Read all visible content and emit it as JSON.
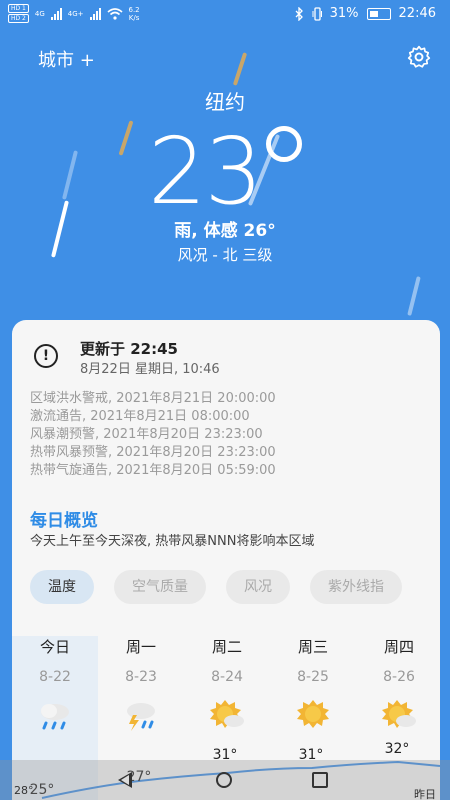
{
  "status_bar": {
    "sim1": "HD 1",
    "sim2": "HD 2",
    "net1": "4G",
    "net2": "4G+",
    "speed_value": "6.2",
    "speed_unit": "K/s",
    "battery": "31%",
    "time": "22:46"
  },
  "header": {
    "city_label": "城市 +",
    "settings_icon": "gear-icon"
  },
  "current": {
    "city": "纽约",
    "temperature": "23",
    "condition": "雨, 体感 26°",
    "wind": "风况 - 北 三级"
  },
  "card": {
    "updated_title": "更新于 22:45",
    "updated_date": "8月22日  星期日, 10:46",
    "warnings": [
      "区域洪水警戒, 2021年8月21日 20:00:00",
      "激流通告, 2021年8月21日 08:00:00",
      "风暴潮预警, 2021年8月20日 23:23:00",
      "热带风暴预警, 2021年8月20日 23:23:00",
      "热带气旋通告, 2021年8月20日 05:59:00"
    ],
    "daily_title": "每日概览",
    "daily_desc": "今天上午至今天深夜, 热带风暴NNN将影响本区域"
  },
  "tabs": [
    "温度",
    "空气质量",
    "风况",
    "紫外线指"
  ],
  "forecast": [
    {
      "day": "今日",
      "date": "8-22",
      "icon": "rain-cloud-icon",
      "high": "",
      "low": "25°"
    },
    {
      "day": "周一",
      "date": "8-23",
      "icon": "thunderstorm-icon",
      "high": "",
      "low": "27°"
    },
    {
      "day": "周二",
      "date": "8-24",
      "icon": "sun-cloud-icon",
      "high": "31°",
      "low": ""
    },
    {
      "day": "周三",
      "date": "8-25",
      "icon": "sun-icon",
      "high": "31°",
      "low": ""
    },
    {
      "day": "周四",
      "date": "8-26",
      "icon": "sun-cloud-icon",
      "high": "32°",
      "low": ""
    }
  ],
  "chart_labels": {
    "left_axis": "28°",
    "right_label": "昨日"
  },
  "colors": {
    "background": "#3f8fe6",
    "accent": "#2f8ce6",
    "card": "#f6f6f6"
  }
}
